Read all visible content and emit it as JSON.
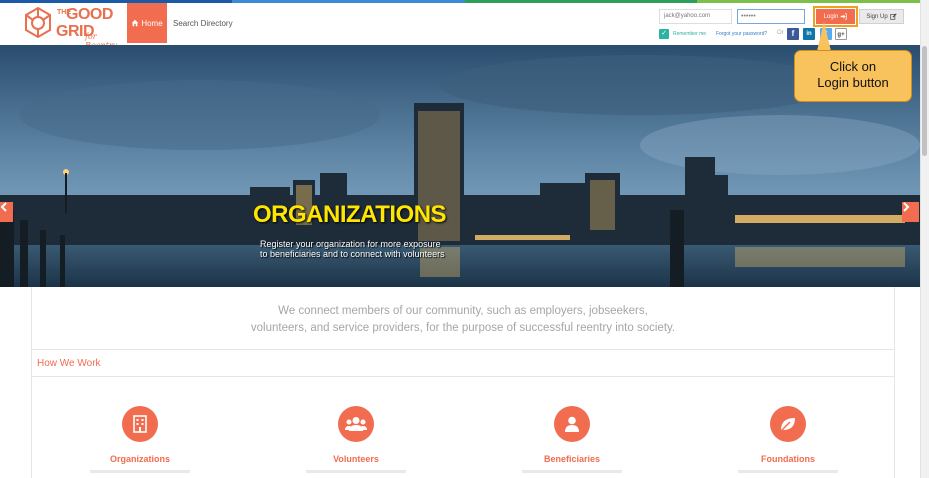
{
  "colors": {
    "accent": "#f26c4f",
    "teal": "#2bb3a3",
    "callout": "#f8c25c",
    "headline": "#ffe600",
    "top_stripe": [
      "#1a5aa8",
      "#3b8ad6",
      "#2e9e5b",
      "#7cc04b"
    ]
  },
  "logo": {
    "the": "THE",
    "good": "GOOD",
    "grid": "GRID",
    "tagline": "for Reentry"
  },
  "nav": {
    "home_label": "Home",
    "home_icon": "home-icon",
    "search_directory_label": "Search Directory"
  },
  "login": {
    "email_value": "jack@yahoo.com",
    "password_value": "••••••",
    "login_label": "Login",
    "login_icon": "sign-in-icon",
    "signup_label": "Sign Up",
    "signup_icon": "edit-icon",
    "remember_label": "Remember me",
    "forgot_label": "Forgot your password?",
    "or_label": "Or"
  },
  "social": {
    "facebook": "f",
    "linkedin": "in",
    "twitter": "t",
    "google": "g+"
  },
  "callout": {
    "line1": "Click on",
    "line2": "Login button"
  },
  "hero": {
    "title": "ORGANIZATIONS",
    "subtitle": "Register your organization for more exposure to beneficiaries and to connect with volunteers",
    "prev_icon": "chevron-left-icon",
    "next_icon": "chevron-right-icon"
  },
  "intro": {
    "line1": "We connect members of our community, such as employers, jobseekers,",
    "line2": "volunteers, and service providers, for the purpose of successful reentry into society."
  },
  "how_we_work": {
    "title": "How We Work",
    "cards": [
      {
        "label": "Organizations",
        "icon": "building-icon"
      },
      {
        "label": "Volunteers",
        "icon": "users-icon"
      },
      {
        "label": "Beneficiaries",
        "icon": "user-icon"
      },
      {
        "label": "Foundations",
        "icon": "leaf-icon"
      }
    ]
  }
}
